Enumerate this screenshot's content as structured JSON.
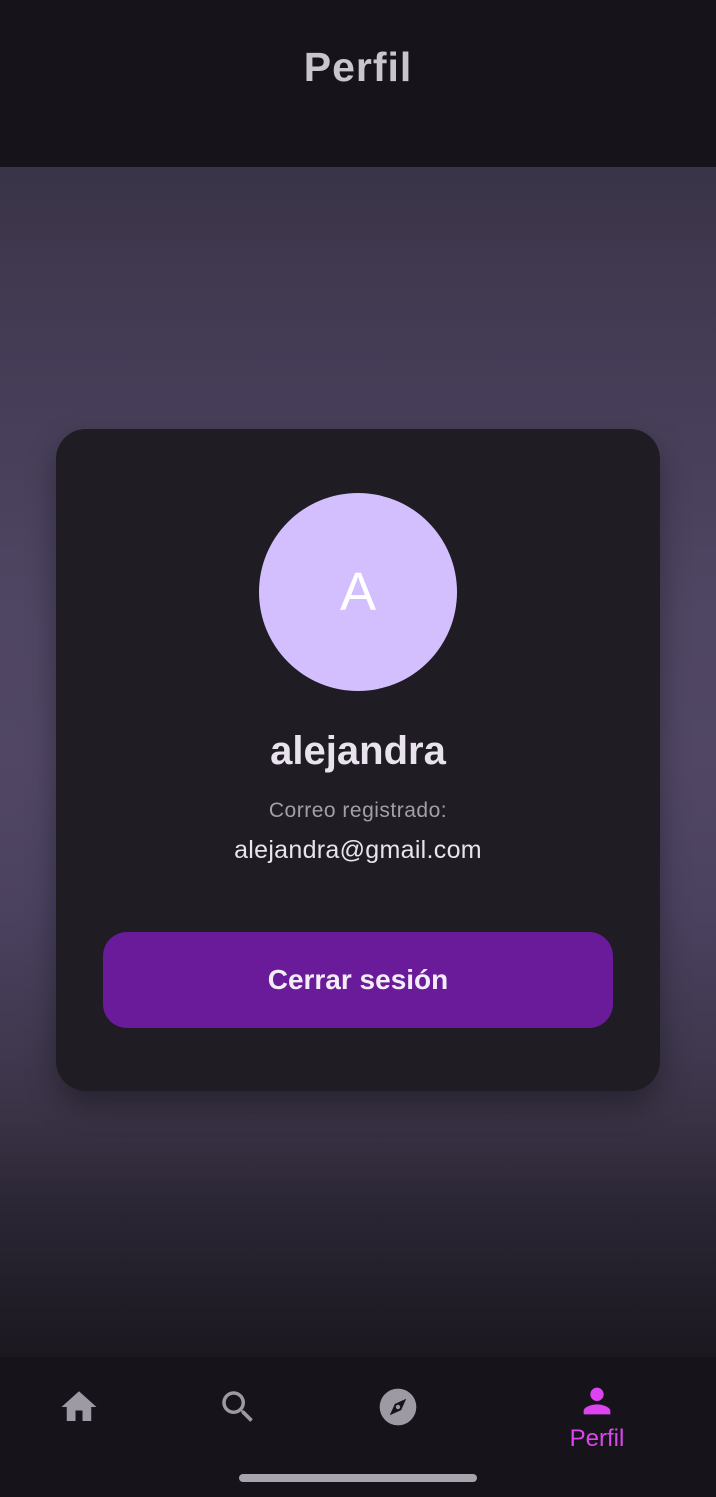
{
  "app_bar": {
    "title": "Perfil"
  },
  "profile": {
    "avatar_letter": "A",
    "username": "alejandra",
    "email_label": "Correo registrado:",
    "email": "alejandra@gmail.com",
    "logout_label": "Cerrar sesión"
  },
  "bottom_nav": {
    "items": [
      {
        "icon": "home-icon",
        "label": "",
        "active": false
      },
      {
        "icon": "search-icon",
        "label": "",
        "active": false
      },
      {
        "icon": "compass-icon",
        "label": "",
        "active": false
      },
      {
        "icon": "person-icon",
        "label": "Perfil",
        "active": true
      }
    ]
  },
  "colors": {
    "accent": "#6a1b9a",
    "active_nav": "#dd44f0",
    "inactive_nav": "#9e9aa3",
    "avatar_bg": "#d3bffd",
    "card_bg": "#1f1c23"
  }
}
